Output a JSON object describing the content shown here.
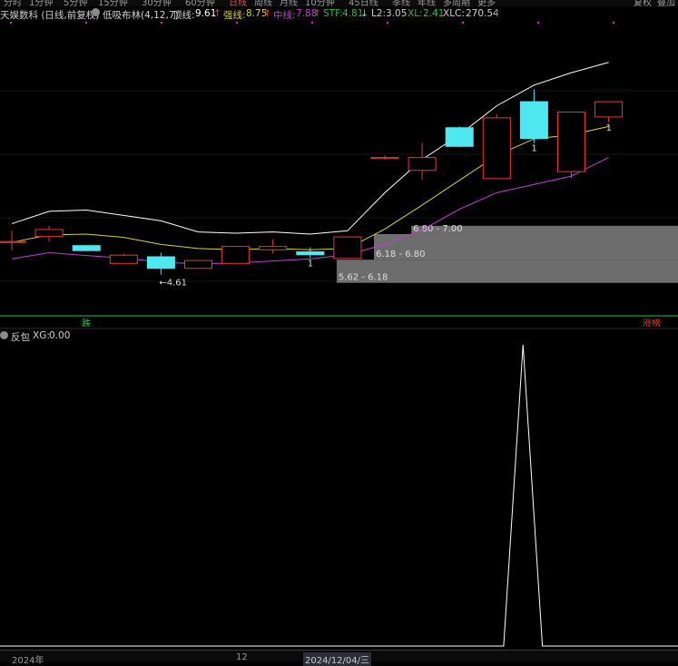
{
  "tabs": [
    "分时",
    "1分钟",
    "5分钟",
    "15分钟",
    "30分钟",
    "60分钟",
    "日线",
    "周线",
    "月线",
    "10分钟",
    "45日线",
    "季线",
    "年线",
    "多周期",
    "更多"
  ],
  "active_tab": "日线",
  "right_tabs": [
    "复权",
    "叠加"
  ],
  "info": {
    "stock": "天娱数科 (日线,前复权)",
    "indicator": "低吸布林(4,12,7)",
    "top_label": "顶线:",
    "top_value": "9.61",
    "strong_label": "强线:",
    "strong_value": "8.75",
    "mid_label": "中线:",
    "mid_value": "7.88",
    "stf_label": "STF:",
    "stf_value": "4.81",
    "l2_label": "L2:",
    "l2_value": "3.05",
    "xl_label": "XL:",
    "xl_value": "2.41",
    "xlc_label": "XLC:",
    "xlc_value": "270.54",
    "up_arrow": "↑",
    "down_arrow": "↓"
  },
  "colors": {
    "up": "#e03a3a",
    "down": "#4fe8f0",
    "top_line": "#ffffff",
    "mid_line": "#d8cf37",
    "low_line": "#c23fd3",
    "zone": "#8c8c8c",
    "signal_green": "#1fc43b",
    "signal_red": "#e03a3a"
  },
  "chart_data": {
    "type": "candlestick",
    "candles": [
      {
        "o": 6.62,
        "c": 6.62,
        "h": 6.88,
        "l": 6.4
      },
      {
        "o": 6.74,
        "c": 6.91,
        "h": 7.0,
        "l": 6.62
      },
      {
        "o": 6.52,
        "c": 6.4,
        "h": 6.52,
        "l": 6.4
      },
      {
        "o": 6.09,
        "c": 6.29,
        "h": 6.33,
        "l": 6.09
      },
      {
        "o": 6.25,
        "c": 5.97,
        "h": 6.35,
        "l": 5.82
      },
      {
        "o": 5.97,
        "c": 6.16,
        "h": 6.16,
        "l": 5.97
      },
      {
        "o": 6.09,
        "c": 6.5,
        "h": 6.5,
        "l": 6.09
      },
      {
        "o": 6.42,
        "c": 6.5,
        "h": 6.68,
        "l": 6.33
      },
      {
        "o": 6.37,
        "c": 6.3,
        "h": 6.48,
        "l": 6.22
      },
      {
        "o": 6.21,
        "c": 6.73,
        "h": 6.73,
        "l": 6.21
      },
      {
        "o": 8.65,
        "c": 8.65,
        "h": 8.7,
        "l": 8.6
      },
      {
        "o": 8.34,
        "c": 8.65,
        "h": 9.0,
        "l": 8.11
      },
      {
        "o": 9.37,
        "c": 8.92,
        "h": 9.4,
        "l": 8.9
      },
      {
        "o": 8.14,
        "c": 9.61,
        "h": 9.7,
        "l": 8.14
      },
      {
        "o": 10.0,
        "c": 9.11,
        "h": 10.3,
        "l": 9.0
      },
      {
        "o": 8.31,
        "c": 9.75,
        "h": 9.75,
        "l": 8.15
      },
      {
        "o": 9.63,
        "c": 10.0,
        "h": 10.0,
        "l": 9.5
      }
    ],
    "top_line": [
      7.05,
      7.35,
      7.38,
      7.25,
      7.12,
      6.85,
      6.82,
      6.85,
      6.8,
      6.88,
      7.8,
      8.6,
      9.2,
      9.9,
      10.4,
      10.7,
      10.95
    ],
    "mid_line": [
      6.6,
      6.78,
      6.8,
      6.72,
      6.55,
      6.45,
      6.42,
      6.45,
      6.42,
      6.45,
      6.92,
      7.5,
      8.1,
      8.7,
      9.1,
      9.2,
      9.4
    ],
    "low_line": [
      6.2,
      6.35,
      6.28,
      6.22,
      6.12,
      6.08,
      6.1,
      6.15,
      6.2,
      6.3,
      6.55,
      6.9,
      7.4,
      7.8,
      8.0,
      8.2,
      8.65
    ],
    "zones": [
      {
        "label": "6.80 - 7.00",
        "low": 6.8,
        "high": 7.0,
        "start": 11
      },
      {
        "label": "6.18 - 6.80",
        "low": 6.18,
        "high": 6.8,
        "start": 10
      },
      {
        "label": "5.62 - 6.18",
        "low": 5.62,
        "high": 6.18,
        "start": 9
      }
    ],
    "low_mark": "←4.61",
    "low_mark_index": 4,
    "marks_one": [
      {
        "index": 8,
        "text": "1"
      },
      {
        "index": 14,
        "text": "1"
      },
      {
        "index": 16,
        "text": "1"
      }
    ],
    "top_dots_count": 9,
    "ylim": [
      5.0,
      11.8
    ],
    "xg_series": [
      0,
      0,
      0,
      0,
      0,
      0,
      0,
      0,
      0,
      0,
      0,
      0,
      0,
      0,
      0,
      0,
      0,
      0,
      0,
      0,
      0,
      0,
      0,
      0,
      0,
      0,
      0,
      1,
      0,
      0,
      0,
      0,
      0,
      0,
      0,
      0
    ],
    "xg_value_max": 1
  },
  "signals": {
    "left_label": "跌",
    "right_label": "涨榜"
  },
  "subinfo": {
    "title": "反包",
    "xg_label": "XG:",
    "xg_value": "0.00"
  },
  "axis": {
    "year": "2024年",
    "month": "12",
    "current": "2024/12/04/三"
  }
}
